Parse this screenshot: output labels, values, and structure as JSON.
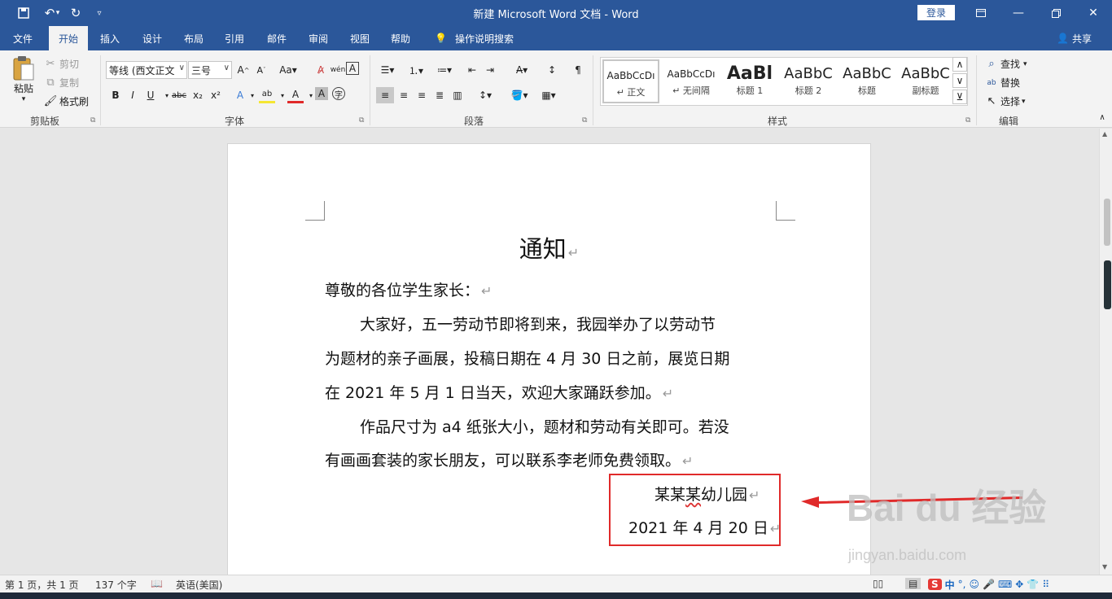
{
  "window": {
    "title": "新建 Microsoft Word 文档  -  Word",
    "login_label": "登录",
    "quick_access": [
      "save-icon",
      "undo-icon",
      "redo-icon",
      "customize-icon"
    ]
  },
  "ribbon_tabs": [
    {
      "label": "文件"
    },
    {
      "label": "开始"
    },
    {
      "label": "插入"
    },
    {
      "label": "设计"
    },
    {
      "label": "布局"
    },
    {
      "label": "引用"
    },
    {
      "label": "邮件"
    },
    {
      "label": "审阅"
    },
    {
      "label": "视图"
    },
    {
      "label": "帮助"
    }
  ],
  "active_tab": "开始",
  "tell_me": "操作说明搜索",
  "share": "共享",
  "clipboard": {
    "paste": "粘贴",
    "cut": "剪切",
    "copy": "复制",
    "format_painter": "格式刷",
    "group_label": "剪贴板"
  },
  "font": {
    "family": "等线 (西文正文",
    "size": "三号",
    "group_label": "字体",
    "buttons": [
      "B",
      "I",
      "U",
      "abc",
      "x₂",
      "x²"
    ]
  },
  "paragraph": {
    "group_label": "段落"
  },
  "styles": {
    "group_label": "样式",
    "items": [
      {
        "preview": "AaBbCcDı",
        "name": "↵ 正文"
      },
      {
        "preview": "AaBbCcDı",
        "name": "↵ 无间隔"
      },
      {
        "preview": "AaBl",
        "name": "标题 1"
      },
      {
        "preview": "AaBbC",
        "name": "标题 2"
      },
      {
        "preview": "AaBbC",
        "name": "标题"
      },
      {
        "preview": "AaBbC",
        "name": "副标题"
      }
    ]
  },
  "editing": {
    "find": "查找",
    "replace": "替换",
    "select": "选择",
    "group_label": "编辑"
  },
  "document": {
    "title": "通知",
    "greeting": "尊敬的各位学生家长：",
    "p1_line1": "大家好，五一劳动节即将到来，我园举办了以劳动节",
    "p1_line2": "为题材的亲子画展，投稿日期在 4 月 30 日之前，展览日期",
    "p1_line3": "在 2021 年 5 月 1 日当天，欢迎大家踊跃参加。",
    "p2_line1": "作品尺寸为 a4 纸张大小，题材和劳动有关即可。若没",
    "p2_line2": "有画画套装的家长朋友，可以联系李老师免费领取。",
    "signature_prefix": "某某",
    "signature_squiggle": "某",
    "signature_rest": "幼儿园",
    "date": "2021 年 4 月 20 日",
    "paragraph_mark": "↵"
  },
  "watermark": {
    "brand": "Bai  du 经验",
    "url": "jingyan.baidu.com"
  },
  "status": {
    "page": "第 1 页，共 1 页",
    "words": "137 个字",
    "language": "英语(美国)",
    "ime_label": "中"
  },
  "colors": {
    "accent": "#2b579a",
    "highlight_box": "#e02a2a",
    "arrow": "#e02a2a"
  }
}
